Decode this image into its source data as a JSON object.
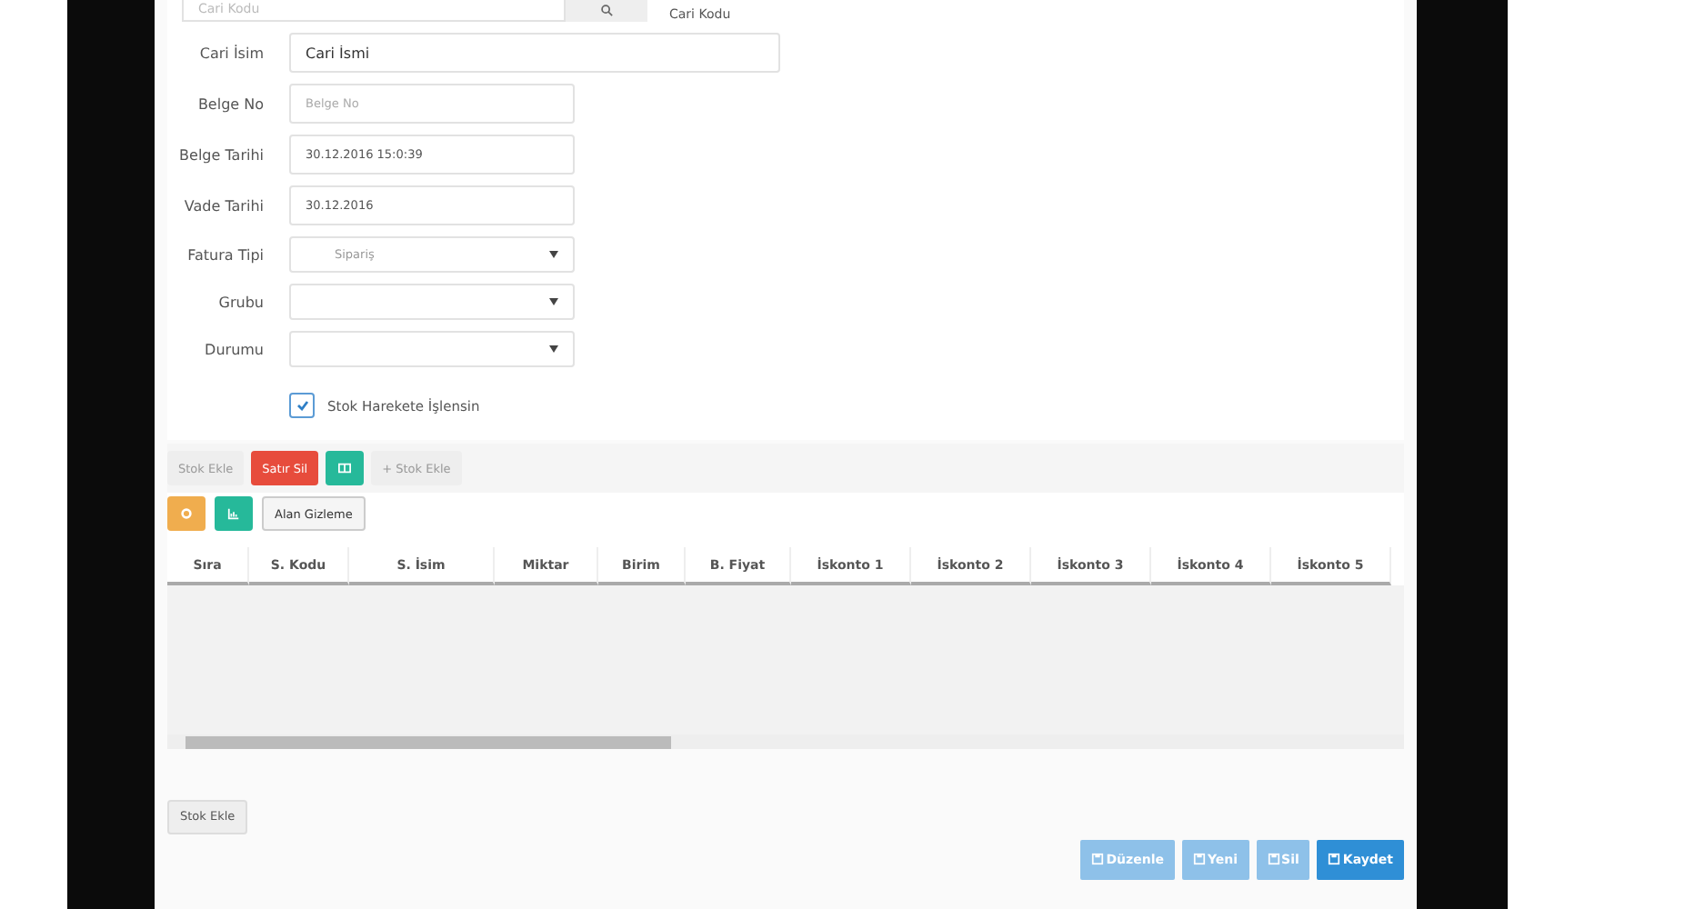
{
  "top_row": {
    "placeholder": "Cari Kodu",
    "label": "Cari Kodu"
  },
  "fields": [
    {
      "kind": "text",
      "label": "Cari İsim",
      "value": "Cari İsmi",
      "wide": true
    },
    {
      "kind": "text",
      "label": "Belge No",
      "placeholder": "Belge No"
    },
    {
      "kind": "text",
      "label": "Belge Tarihi",
      "value": "30.12.2016 15:0:39"
    },
    {
      "kind": "text",
      "label": "Vade Tarihi",
      "value": "30.12.2016"
    },
    {
      "kind": "select",
      "label": "Fatura Tipi",
      "placeholder": "Sipariş"
    },
    {
      "kind": "select",
      "label": "Grubu"
    },
    {
      "kind": "select",
      "label": "Durumu"
    }
  ],
  "stock_checkbox": {
    "label": "Stok Harekete İşlensin",
    "checked": true
  },
  "toolbar": [
    {
      "kind": "plain",
      "label": "Stok Ekle"
    },
    {
      "kind": "danger",
      "label": "Satır Sil"
    },
    {
      "kind": "success-icon"
    },
    {
      "kind": "plain",
      "label": "+ Stok Ekle"
    }
  ],
  "toolbar2": [
    {
      "kind": "warning-icon"
    },
    {
      "kind": "chart-icon"
    },
    {
      "kind": "outline",
      "label": "Alan Gizleme"
    }
  ],
  "table": {
    "columns": [
      "Sıra",
      "S. Kodu",
      "S. İsim",
      "Miktar",
      "Birim",
      "B. Fiyat",
      "İskonto 1",
      "İskonto 2",
      "İskonto 3",
      "İskonto 4",
      "İskonto 5"
    ]
  },
  "footer_button": "Stok Ekle",
  "actions": [
    {
      "label": "Düzenle",
      "disabled": true
    },
    {
      "label": "Yeni",
      "disabled": true
    },
    {
      "label": "Sil",
      "disabled": true
    },
    {
      "label": "Kaydet",
      "disabled": false
    }
  ]
}
